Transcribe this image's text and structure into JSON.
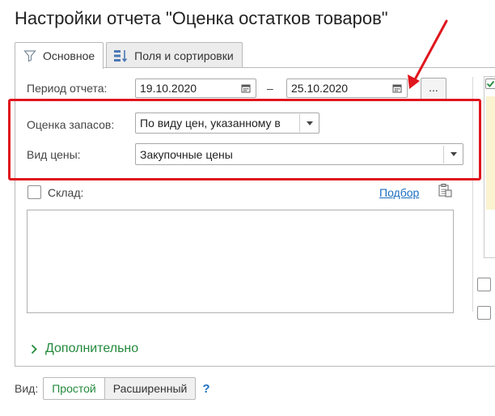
{
  "window": {
    "title": "Настройки отчета \"Оценка остатков товаров\""
  },
  "tabs": [
    {
      "label": "Основное",
      "icon": "filter-icon",
      "active": true
    },
    {
      "label": "Поля и сортировки",
      "icon": "fields-sort-icon",
      "active": false
    }
  ],
  "period": {
    "label": "Период отчета:",
    "from": "19.10.2020",
    "dash": "–",
    "to": "25.10.2020",
    "more_label": "..."
  },
  "stock_eval": {
    "label": "Оценка запасов:",
    "value": "По виду цен, указанному в"
  },
  "price_type": {
    "label": "Вид цены:",
    "value": "Закупочные цены"
  },
  "warehouse": {
    "label": "Склад:",
    "checked": false,
    "select_link": "Подбор",
    "icon": "paste-list-icon"
  },
  "more": {
    "label": "Дополнительно"
  },
  "mode": {
    "label": "Вид:",
    "options": [
      "Простой",
      "Расширенный"
    ],
    "selected": "Простой",
    "help": "?"
  },
  "colors": {
    "accent_red": "#e0161e",
    "green": "#238a3c",
    "link_blue": "#1b6fc2"
  }
}
